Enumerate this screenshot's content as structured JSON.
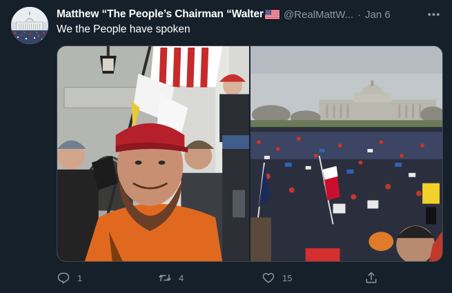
{
  "tweet": {
    "author_name": "Matthew “The People’s Chairman “Walter",
    "handle": "@RealMattW...",
    "separator": "·",
    "time": "Jan 6",
    "more_label": "•••",
    "text": "We the People have spoken"
  },
  "actions": {
    "reply_count": "1",
    "retweet_count": "4",
    "like_count": "15"
  },
  "icons": {
    "avatar": "capitol-building-avatar",
    "flag": "us-flag-emoji",
    "reply": "reply-icon",
    "retweet": "retweet-icon",
    "like": "heart-icon",
    "share": "share-icon"
  },
  "colors": {
    "background": "#15202b",
    "secondary_text": "#8899a6",
    "border": "#38444d"
  }
}
